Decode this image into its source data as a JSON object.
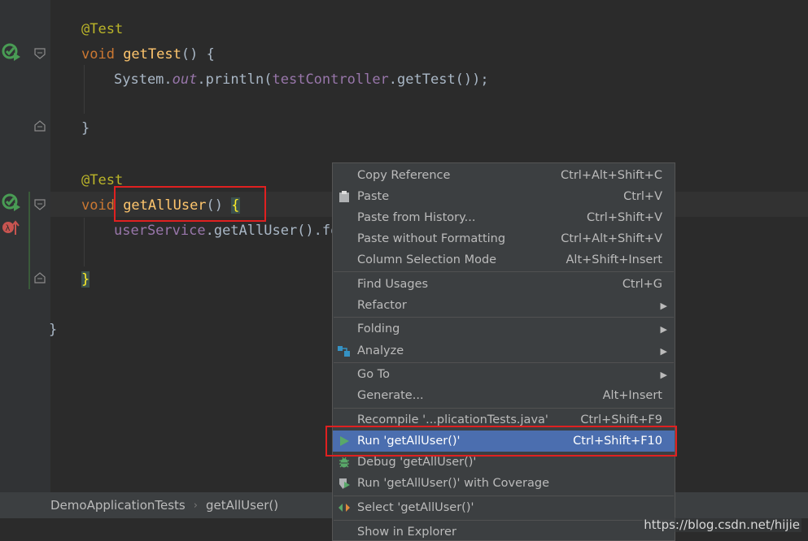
{
  "editor": {
    "lines": {
      "ann1": "@Test",
      "void1": "void ",
      "fn1": "getTest",
      "paren1": "() ",
      "brace1": "{",
      "sys": "System.",
      "out": "out",
      "println": ".println(",
      "tc": "testController",
      "getTestCall": ".getTest());",
      "close1": "}",
      "ann2": "@Test",
      "void2": "void ",
      "fn2": "getAllUser",
      "paren2": "() ",
      "brace2": "{",
      "us": "userService",
      "getAllUserCall": ".getAllUser().fo",
      "close2": "}",
      "close3": "}"
    }
  },
  "breadcrumb": {
    "class_name": "DemoApplicationTests",
    "method_name": "getAllUser()"
  },
  "context_menu": {
    "copy_reference": {
      "label": "Copy Reference",
      "shortcut": "Ctrl+Alt+Shift+C"
    },
    "paste": {
      "label": "Paste",
      "shortcut": "Ctrl+V"
    },
    "paste_history": {
      "label": "Paste from History...",
      "shortcut": "Ctrl+Shift+V"
    },
    "paste_no_format": {
      "label": "Paste without Formatting",
      "shortcut": "Ctrl+Alt+Shift+V"
    },
    "column_selection": {
      "label": "Column Selection Mode",
      "shortcut": "Alt+Shift+Insert"
    },
    "find_usages": {
      "label": "Find Usages",
      "shortcut": "Ctrl+G"
    },
    "refactor": {
      "label": "Refactor"
    },
    "folding": {
      "label": "Folding"
    },
    "analyze": {
      "label": "Analyze"
    },
    "go_to": {
      "label": "Go To"
    },
    "generate": {
      "label": "Generate...",
      "shortcut": "Alt+Insert"
    },
    "recompile": {
      "label": "Recompile '...plicationTests.java'",
      "shortcut": "Ctrl+Shift+F9"
    },
    "run": {
      "label": "Run 'getAllUser()'",
      "shortcut": "Ctrl+Shift+F10"
    },
    "debug": {
      "label": "Debug 'getAllUser()'"
    },
    "run_coverage": {
      "label": "Run 'getAllUser()' with Coverage"
    },
    "select": {
      "label": "Select 'getAllUser()'"
    },
    "show_explorer": {
      "label": "Show in Explorer"
    }
  },
  "watermark": "https://blog.csdn.net/hijie",
  "colors": {
    "editor_bg": "#2b2b2b",
    "menu_bg": "#3c3f41",
    "selected_bg": "#4b6eaf",
    "highlight_red": "#e02020",
    "run_green": "#499c54"
  }
}
